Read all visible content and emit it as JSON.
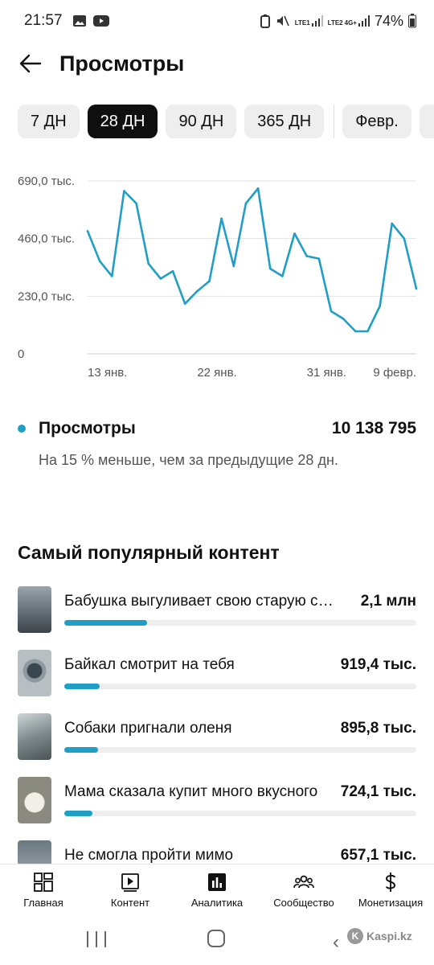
{
  "status_bar": {
    "time": "21:57",
    "sim1": "LTE1",
    "sim2": "LTE2",
    "network": "4G+",
    "battery": "74%"
  },
  "header": {
    "title": "Просмотры"
  },
  "chips": [
    {
      "label": "7 ДН",
      "active": false
    },
    {
      "label": "28 ДН",
      "active": true
    },
    {
      "label": "90 ДН",
      "active": false
    },
    {
      "label": "365 ДН",
      "active": false
    },
    {
      "label": "Февр.",
      "active": false
    }
  ],
  "chart_data": {
    "type": "line",
    "title": "",
    "xlabel": "",
    "ylabel": "",
    "ylim": [
      0,
      690000
    ],
    "y_ticks": [
      "690,0 тыс.",
      "460,0 тыс.",
      "230,0 тыс.",
      "0"
    ],
    "x_ticks": [
      "13 янв.",
      "22 янв.",
      "31 янв.",
      "9 февр."
    ],
    "grid": true,
    "color": "#1f9fc6",
    "series": [
      {
        "values": [
          490000,
          370000,
          310000,
          650000,
          600000,
          360000,
          300000,
          330000,
          200000,
          250000,
          290000,
          540000,
          350000,
          600000,
          660000,
          340000,
          310000,
          480000,
          390000,
          380000,
          170000,
          140000,
          90000,
          90000,
          190000,
          520000,
          460000,
          260000
        ]
      }
    ]
  },
  "metric": {
    "name": "Просмотры",
    "value": "10 138 795",
    "sub": "На 15 % меньше, чем за предыдущие 28 дн.",
    "color": "#1f9fc6"
  },
  "popular": {
    "title": "Самый популярный контент",
    "items": [
      {
        "name": "Бабушка выгуливает свою старую собаку",
        "value": "2,1 млн",
        "fraction": 0.235
      },
      {
        "name": "Байкал смотрит на тебя",
        "value": "919,4 тыс.",
        "fraction": 0.1
      },
      {
        "name": "Собаки пригнали оленя",
        "value": "895,8 тыс.",
        "fraction": 0.097
      },
      {
        "name": "Мама сказала купит много вкусного",
        "value": "724,1 тыс.",
        "fraction": 0.08
      },
      {
        "name": "Не смогла пройти мимо",
        "value": "657,1 тыс.",
        "fraction": 0.07
      }
    ]
  },
  "bottom_nav": [
    {
      "label": "Главная",
      "icon": "home-grid-icon"
    },
    {
      "label": "Контент",
      "icon": "content-icon"
    },
    {
      "label": "Аналитика",
      "icon": "analytics-icon"
    },
    {
      "label": "Сообщество",
      "icon": "community-icon"
    },
    {
      "label": "Монетизация",
      "icon": "dollar-icon"
    }
  ],
  "watermark": "Kaspi.kz"
}
